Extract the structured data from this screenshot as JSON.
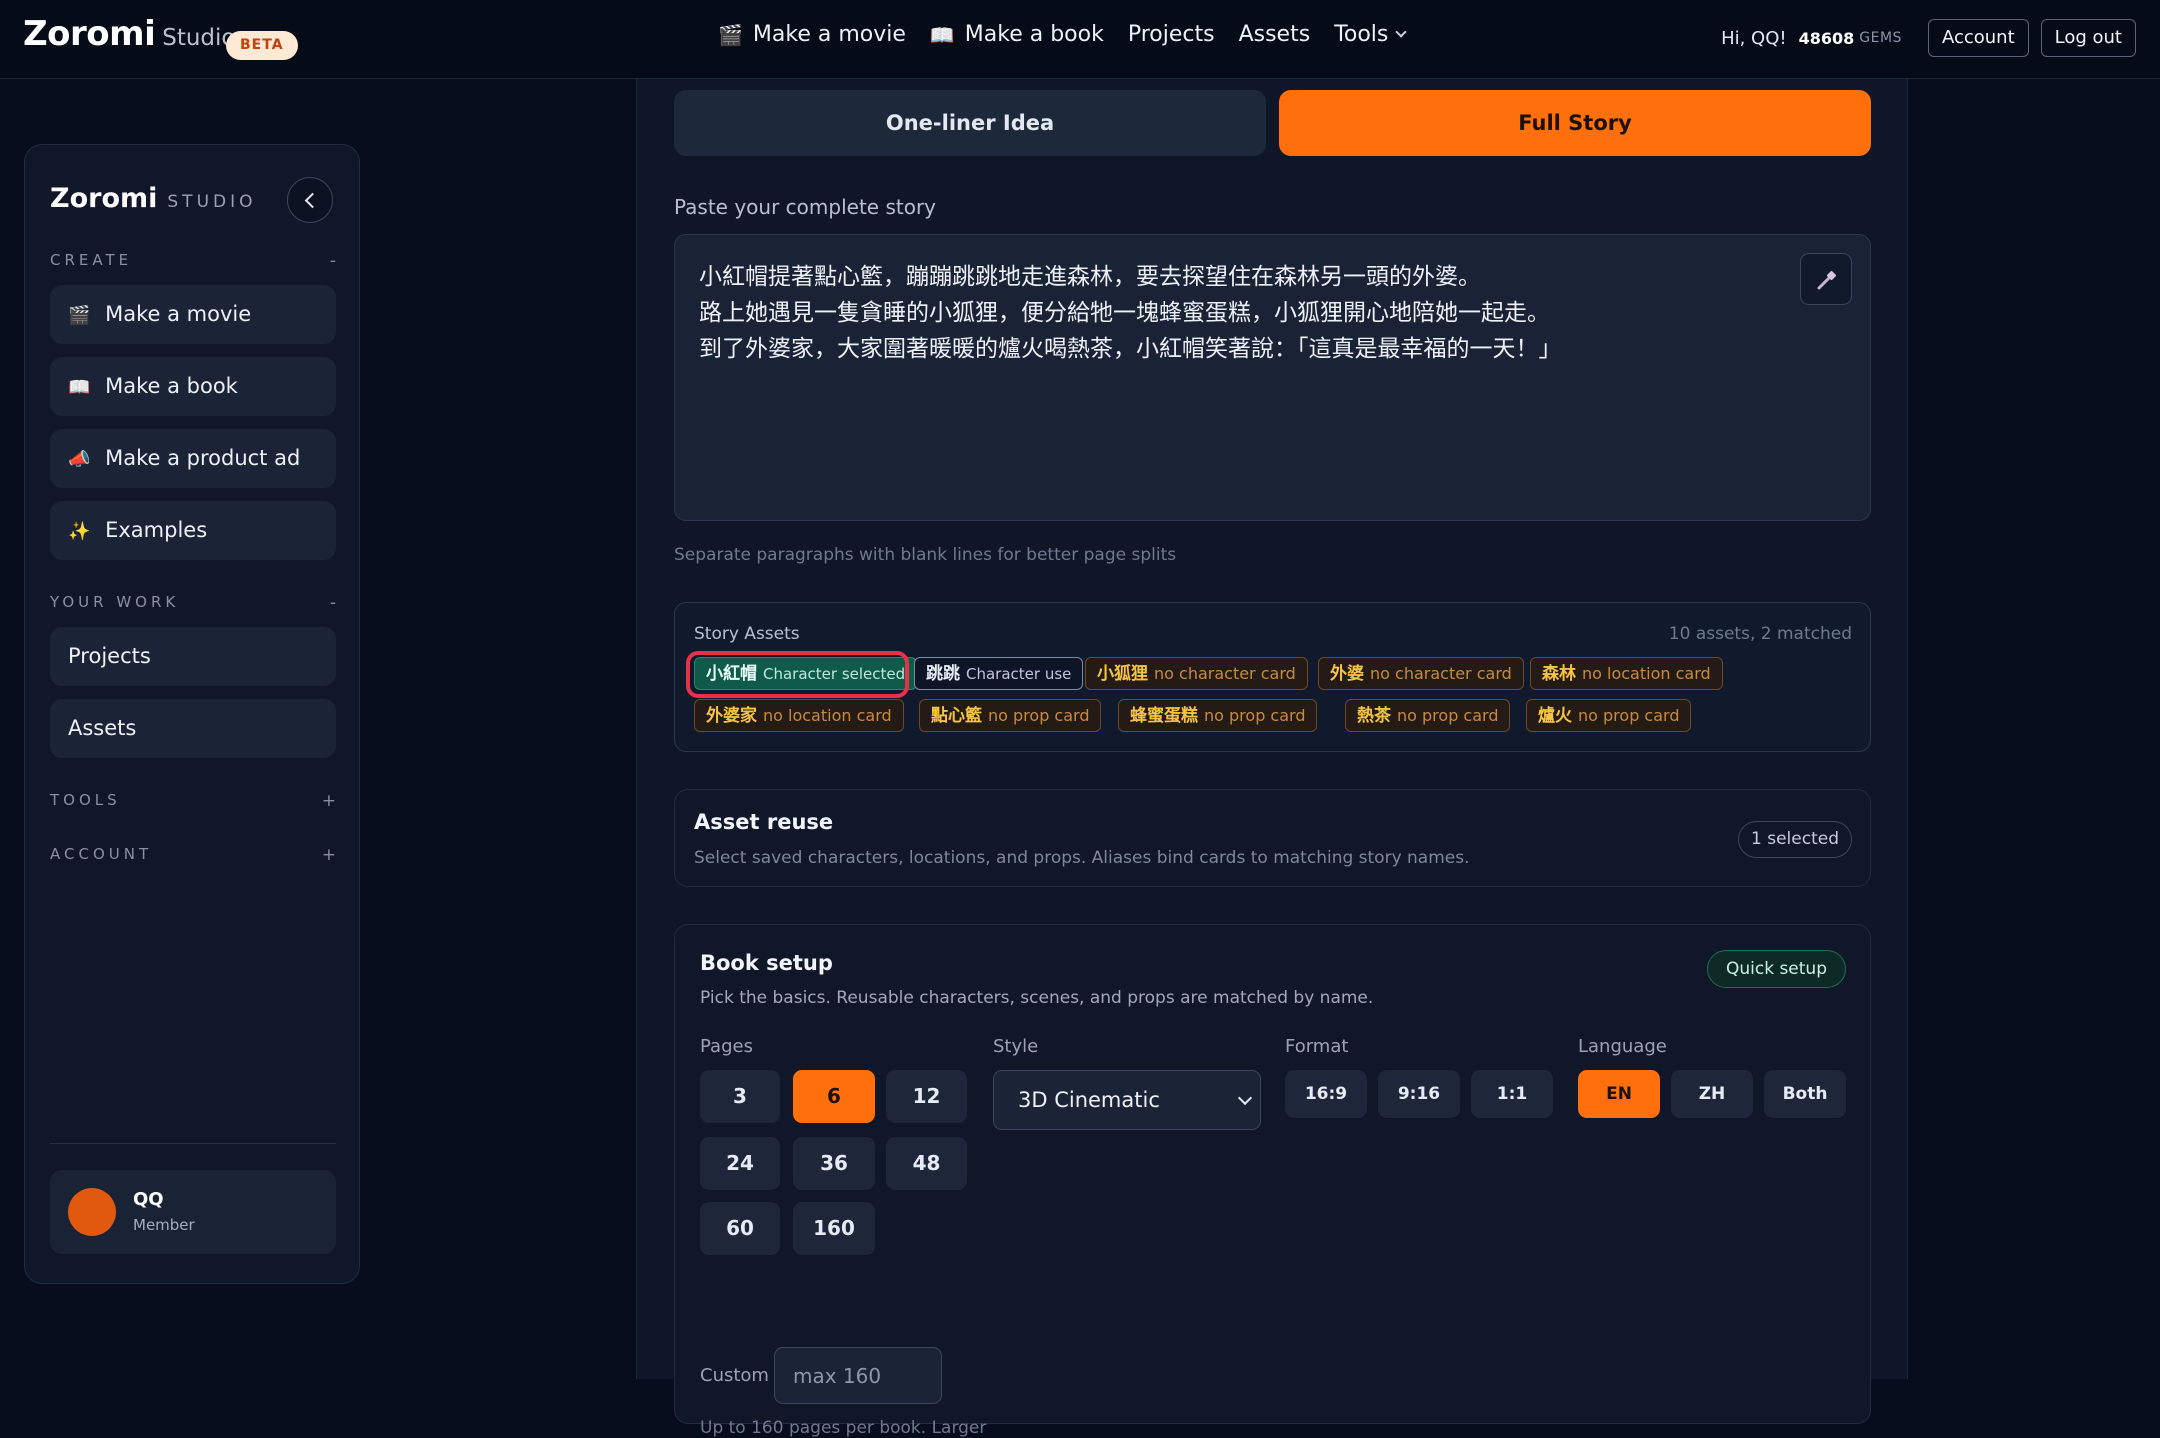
{
  "brand": {
    "name": "Zoromi",
    "sub": "Studio",
    "badge": "BETA"
  },
  "topnav": {
    "movie_icon": "🎬",
    "movie": "Make a movie",
    "book_icon": "📖",
    "book": "Make a book",
    "projects": "Projects",
    "assets": "Assets",
    "tools": "Tools"
  },
  "user": {
    "greeting": "Hi, QQ!",
    "gems": "48608",
    "gems_label": "GEMS",
    "account": "Account",
    "logout": "Log out"
  },
  "sidebar": {
    "brand": "Zoromi",
    "brand_sub": "STUDIO",
    "create_head": "CREATE",
    "create_toggle": "-",
    "items": [
      {
        "icon": "🎬",
        "label": "Make a movie"
      },
      {
        "icon": "📖",
        "label": "Make a book"
      },
      {
        "icon": "📣",
        "label": "Make a product ad"
      },
      {
        "icon": "✨",
        "label": "Examples"
      }
    ],
    "work_head": "YOUR WORK",
    "work_toggle": "-",
    "work_items": [
      "Projects",
      "Assets"
    ],
    "tools_head": "TOOLS",
    "tools_toggle": "+",
    "account_head": "ACCOUNT",
    "account_toggle": "+",
    "user_name": "QQ",
    "user_role": "Member"
  },
  "main": {
    "tab_one": "One-liner Idea",
    "tab_full": "Full Story",
    "paste_label": "Paste your complete story",
    "story": "小紅帽提著點心籃，蹦蹦跳跳地走進森林，要去探望住在森林另一頭的外婆。\n路上她遇見一隻貪睡的小狐狸，便分給牠一塊蜂蜜蛋糕，小狐狸開心地陪她一起走。\n到了外婆家，大家圍著暖暖的爐火喝熱茶，小紅帽笑著說：「這真是最幸福的一天！」",
    "hint": "Separate paragraphs with blank lines for better page splits"
  },
  "story_assets": {
    "title": "Story Assets",
    "count": "10 assets, 2 matched",
    "chips": [
      {
        "name": "小紅帽",
        "status": "Character selected"
      },
      {
        "name": "跳跳",
        "status": "Character use"
      },
      {
        "name": "小狐狸",
        "status": "no character card"
      },
      {
        "name": "外婆",
        "status": "no character card"
      },
      {
        "name": "森林",
        "status": "no location card"
      },
      {
        "name": "外婆家",
        "status": "no location card"
      },
      {
        "name": "點心籃",
        "status": "no prop card"
      },
      {
        "name": "蜂蜜蛋糕",
        "status": "no prop card"
      },
      {
        "name": "熱茶",
        "status": "no prop card"
      },
      {
        "name": "爐火",
        "status": "no prop card"
      }
    ]
  },
  "asset_reuse": {
    "title": "Asset reuse",
    "sub": "Select saved characters, locations, and props. Aliases bind cards to matching story names.",
    "pill": "1 selected"
  },
  "book_setup": {
    "title": "Book setup",
    "sub": "Pick the basics. Reusable characters, scenes, and props are matched by name.",
    "quick": "Quick setup",
    "pages_label": "Pages",
    "pages": [
      "3",
      "6",
      "12",
      "24",
      "36",
      "48",
      "60",
      "160"
    ],
    "pages_selected": "6",
    "style_label": "Style",
    "style_value": "3D Cinematic",
    "format_label": "Format",
    "formats": [
      "16:9",
      "9:16",
      "1:1"
    ],
    "language_label": "Language",
    "languages": [
      "EN",
      "ZH",
      "Both"
    ],
    "language_selected": "EN",
    "custom_label": "Custom",
    "custom_placeholder": "max 160",
    "note": "Up to 160 pages per book. Larger"
  },
  "colors": {
    "accent": "#ff6f0b",
    "selected_chip": "#0f5a48",
    "missing_chip_text": "#f5c542",
    "highlight_ring": "#e2334b"
  }
}
